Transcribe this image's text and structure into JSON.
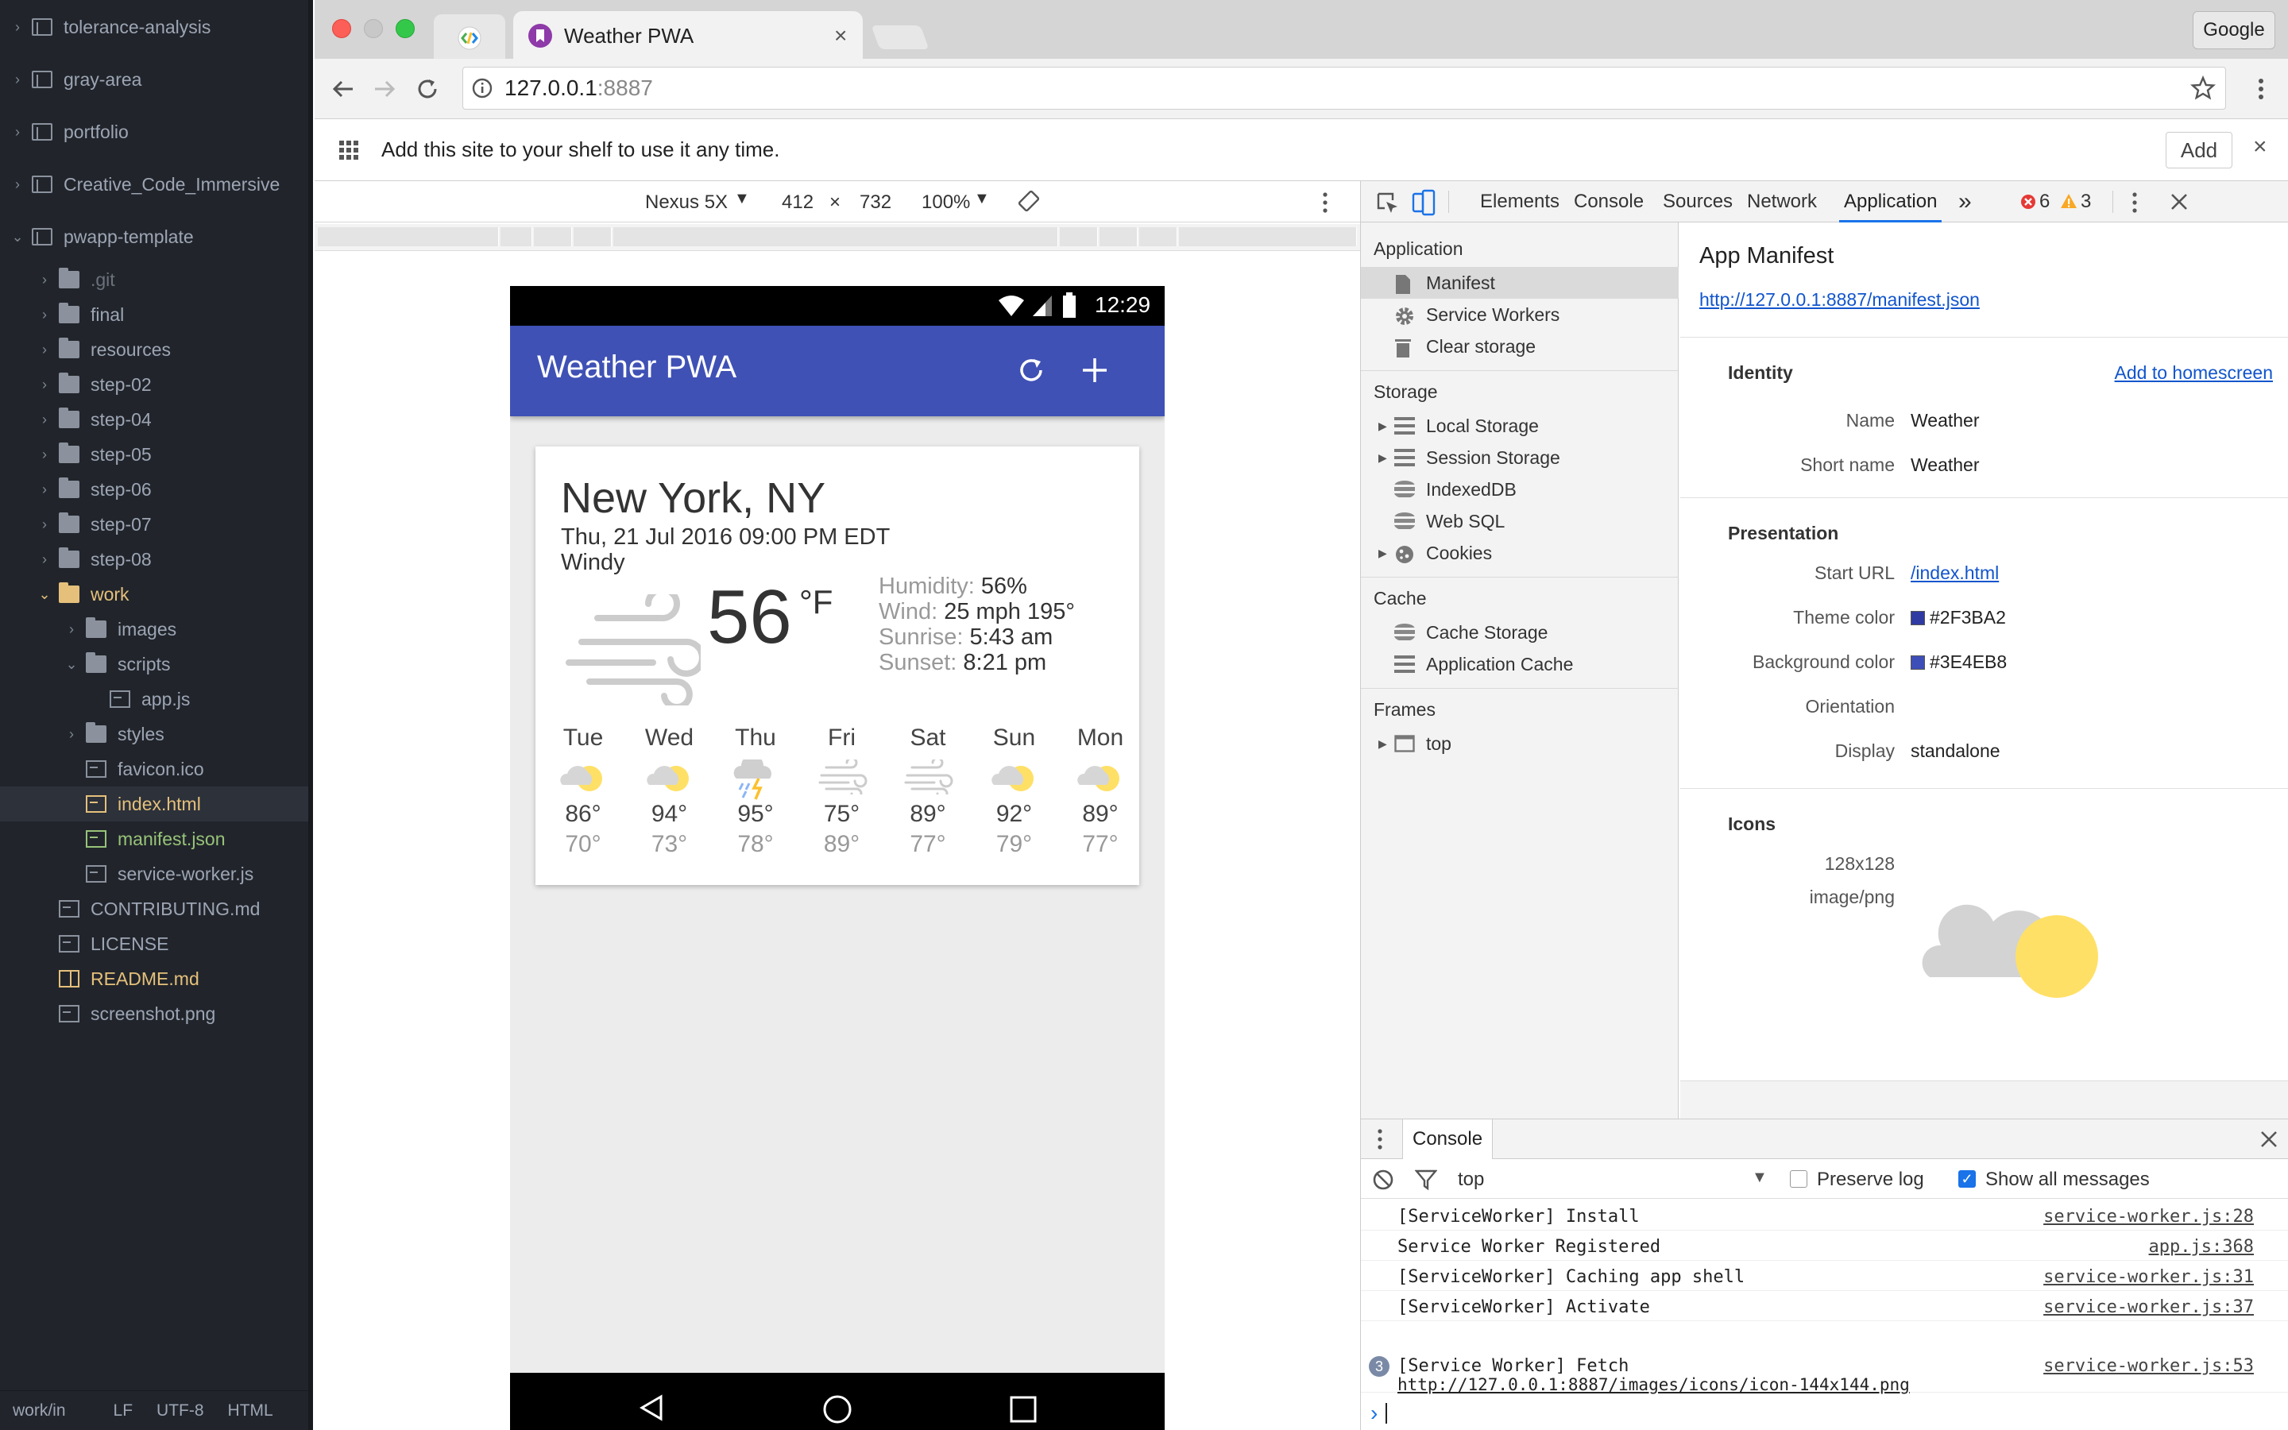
{
  "editor": {
    "tree": [
      {
        "label": "tolerance-analysis",
        "kind": "repo",
        "depth": 0,
        "arrow": "›"
      },
      {
        "label": "gray-area",
        "kind": "repo",
        "depth": 0,
        "arrow": "›"
      },
      {
        "label": "portfolio",
        "kind": "repo",
        "depth": 0,
        "arrow": "›"
      },
      {
        "label": "Creative_Code_Immersive",
        "kind": "repo",
        "depth": 0,
        "arrow": "›"
      },
      {
        "label": "pwapp-template",
        "kind": "repo",
        "depth": 0,
        "arrow": "⌄"
      },
      {
        "label": ".git",
        "kind": "folder",
        "depth": 1,
        "arrow": "›"
      },
      {
        "label": "final",
        "kind": "folder",
        "depth": 1,
        "arrow": "›"
      },
      {
        "label": "resources",
        "kind": "folder",
        "depth": 1,
        "arrow": "›"
      },
      {
        "label": "step-02",
        "kind": "folder",
        "depth": 1,
        "arrow": "›"
      },
      {
        "label": "step-04",
        "kind": "folder",
        "depth": 1,
        "arrow": "›"
      },
      {
        "label": "step-05",
        "kind": "folder",
        "depth": 1,
        "arrow": "›"
      },
      {
        "label": "step-06",
        "kind": "folder",
        "depth": 1,
        "arrow": "›"
      },
      {
        "label": "step-07",
        "kind": "folder",
        "depth": 1,
        "arrow": "›"
      },
      {
        "label": "step-08",
        "kind": "folder",
        "depth": 1,
        "arrow": "›"
      },
      {
        "label": "work",
        "kind": "folder-open",
        "depth": 1,
        "arrow": "⌄"
      },
      {
        "label": "images",
        "kind": "folder",
        "depth": 2,
        "arrow": "›"
      },
      {
        "label": "scripts",
        "kind": "folder",
        "depth": 2,
        "arrow": "⌄"
      },
      {
        "label": "app.js",
        "kind": "file",
        "depth": 3,
        "arrow": ""
      },
      {
        "label": "styles",
        "kind": "folder",
        "depth": 2,
        "arrow": "›"
      },
      {
        "label": "favicon.ico",
        "kind": "image",
        "depth": 2,
        "arrow": ""
      },
      {
        "label": "index.html",
        "kind": "file-modified",
        "depth": 2,
        "arrow": ""
      },
      {
        "label": "manifest.json",
        "kind": "file-new",
        "depth": 2,
        "arrow": ""
      },
      {
        "label": "service-worker.js",
        "kind": "file",
        "depth": 2,
        "arrow": ""
      },
      {
        "label": "CONTRIBUTING.md",
        "kind": "file",
        "depth": 1,
        "arrow": ""
      },
      {
        "label": "LICENSE",
        "kind": "file",
        "depth": 1,
        "arrow": ""
      },
      {
        "label": "README.md",
        "kind": "book",
        "depth": 1,
        "arrow": ""
      },
      {
        "label": "screenshot.png",
        "kind": "image",
        "depth": 1,
        "arrow": ""
      }
    ],
    "status": {
      "path": "work/in",
      "eol": "LF",
      "encoding": "UTF-8",
      "grammar": "HTML"
    }
  },
  "browser": {
    "tab_title": "Weather PWA",
    "tab_close": "×",
    "profile_button": "Google",
    "url_host": "127.0.0.1",
    "url_port": ":8887",
    "infobar_text": "Add this site to your shelf to use it any time.",
    "infobar_add": "Add",
    "infobar_close": "×"
  },
  "device_toolbar": {
    "device": "Nexus 5X",
    "width": "412",
    "times": "×",
    "height": "732",
    "zoom": "100%"
  },
  "phone": {
    "time": "12:29",
    "app_title": "Weather PWA",
    "city": "New York, NY",
    "date": "Thu, 21 Jul 2016 09:00 PM EDT",
    "description": "Windy",
    "temperature": "56",
    "unit": "°F",
    "humidity_label": "Humidity:",
    "humidity": "56%",
    "wind_label": "Wind:",
    "wind": "25 mph 195°",
    "sunrise_label": "Sunrise:",
    "sunrise": "5:43 am",
    "sunset_label": "Sunset:",
    "sunset": "8:21 pm",
    "forecast": [
      {
        "day": "Tue",
        "icon": "partly-cloudy-icon",
        "high": "86°",
        "low": "70°"
      },
      {
        "day": "Wed",
        "icon": "partly-cloudy-icon",
        "high": "94°",
        "low": "73°"
      },
      {
        "day": "Thu",
        "icon": "thunderstorm-icon",
        "high": "95°",
        "low": "78°"
      },
      {
        "day": "Fri",
        "icon": "windy-icon",
        "high": "75°",
        "low": "89°"
      },
      {
        "day": "Sat",
        "icon": "windy-icon",
        "high": "89°",
        "low": "77°"
      },
      {
        "day": "Sun",
        "icon": "partly-cloudy-icon",
        "high": "92°",
        "low": "79°"
      },
      {
        "day": "Mon",
        "icon": "partly-cloudy-icon",
        "high": "89°",
        "low": "77°"
      }
    ]
  },
  "devtools": {
    "tabs": [
      "Elements",
      "Console",
      "Sources",
      "Network",
      "Application"
    ],
    "active_tab": "Application",
    "more": "»",
    "errors": "6",
    "warnings": "3",
    "sidebar": {
      "application_title": "Application",
      "application_items": [
        "Manifest",
        "Service Workers",
        "Clear storage"
      ],
      "storage_title": "Storage",
      "storage_items": [
        "Local Storage",
        "Session Storage",
        "IndexedDB",
        "Web SQL",
        "Cookies"
      ],
      "cache_title": "Cache",
      "cache_items": [
        "Cache Storage",
        "Application Cache"
      ],
      "frames_title": "Frames",
      "frames_items": [
        "top"
      ]
    },
    "manifest": {
      "title": "App Manifest",
      "url": "http://127.0.0.1:8887/manifest.json",
      "identity_title": "Identity",
      "add_homescreen": "Add to homescreen",
      "name_label": "Name",
      "name": "Weather",
      "short_name_label": "Short name",
      "short_name": "Weather",
      "presentation_title": "Presentation",
      "start_url_label": "Start URL",
      "start_url": "/index.html",
      "theme_color_label": "Theme color",
      "theme_color": "#2F3BA2",
      "background_color_label": "Background color",
      "background_color": "#3E4EB8",
      "orientation_label": "Orientation",
      "display_label": "Display",
      "display": "standalone",
      "icons_title": "Icons",
      "icon_size": "128x128",
      "icon_type": "image/png"
    },
    "console": {
      "tab": "Console",
      "context": "top",
      "preserve_log": "Preserve log",
      "show_all": "Show all messages",
      "messages": [
        {
          "text": "[ServiceWorker] Install",
          "source": "service-worker.js:28"
        },
        {
          "text": "Service Worker Registered",
          "source": "app.js:368"
        },
        {
          "text": "[ServiceWorker] Caching app shell",
          "source": "service-worker.js:31"
        },
        {
          "text": "[ServiceWorker] Activate",
          "source": "service-worker.js:37"
        }
      ],
      "fetch_count": "3",
      "fetch_text": "[Service Worker] Fetch",
      "fetch_url": "http://127.0.0.1:8887/images/icons/icon-144x144.png",
      "fetch_source": "service-worker.js:53",
      "prompt": "›"
    }
  },
  "colors": {
    "app_bar": "#3f51b5",
    "theme": "#2F3BA2",
    "background": "#3E4EB8",
    "sun": "#ffe066",
    "accent_tab": "#1a73e8"
  }
}
